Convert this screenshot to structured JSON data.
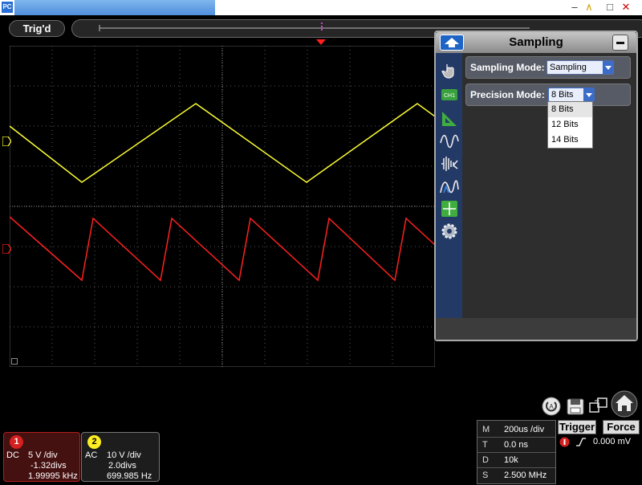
{
  "window": {
    "app_icon_text": "PC"
  },
  "trigger_state": "Trig'd",
  "panel": {
    "title": "Sampling",
    "sampling_mode": {
      "label": "Sampling Mode:",
      "value": "Sampling"
    },
    "precision_mode": {
      "label": "Precision Mode:",
      "value": "8 Bits",
      "options": [
        "8 Bits",
        "12 Bits",
        "14 Bits"
      ]
    },
    "side_icons": [
      "hand-icon",
      "ch1-icon",
      "ruler-icon",
      "waveform-icon",
      "fft-icon",
      "math-wave-icon",
      "crosshair-icon",
      "gear-icon"
    ]
  },
  "ch1": {
    "num": "1",
    "coupling": "DC",
    "volts": "5 V /div",
    "offset": "-1.32divs",
    "freq": "1.99995 kHz",
    "color": "#ffff33"
  },
  "ch2": {
    "num": "2",
    "coupling": "AC",
    "volts": "10 V /div",
    "offset": "2.0divs",
    "freq": "699.985 Hz",
    "color": "#ff2020"
  },
  "timebase": {
    "m_key": "M",
    "m_val": "200us /div",
    "t_key": "T",
    "t_val": "0.0 ns",
    "d_key": "D",
    "d_val": "10k",
    "s_key": "S",
    "s_val": "2.500 MHz"
  },
  "trigger": {
    "button": "Trigger",
    "force": "Force",
    "level": "0.000 mV"
  }
}
